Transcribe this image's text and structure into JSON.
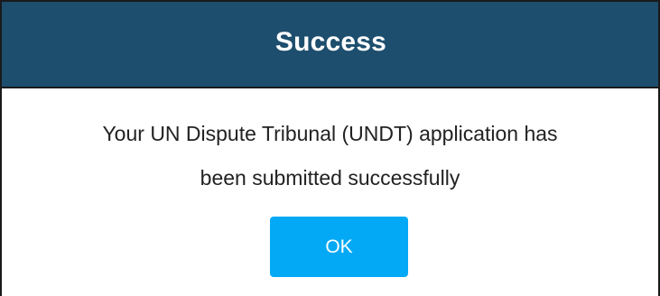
{
  "dialog": {
    "title": "Success",
    "message_line1": "Your UN Dispute Tribunal (UNDT) application has",
    "message_line2": "been submitted successfully",
    "ok_label": "OK"
  },
  "colors": {
    "header_bg": "#1d4e6e",
    "header_text": "#ffffff",
    "button_bg": "#03a9f4",
    "button_text": "#ffffff",
    "message_text": "#222222"
  }
}
